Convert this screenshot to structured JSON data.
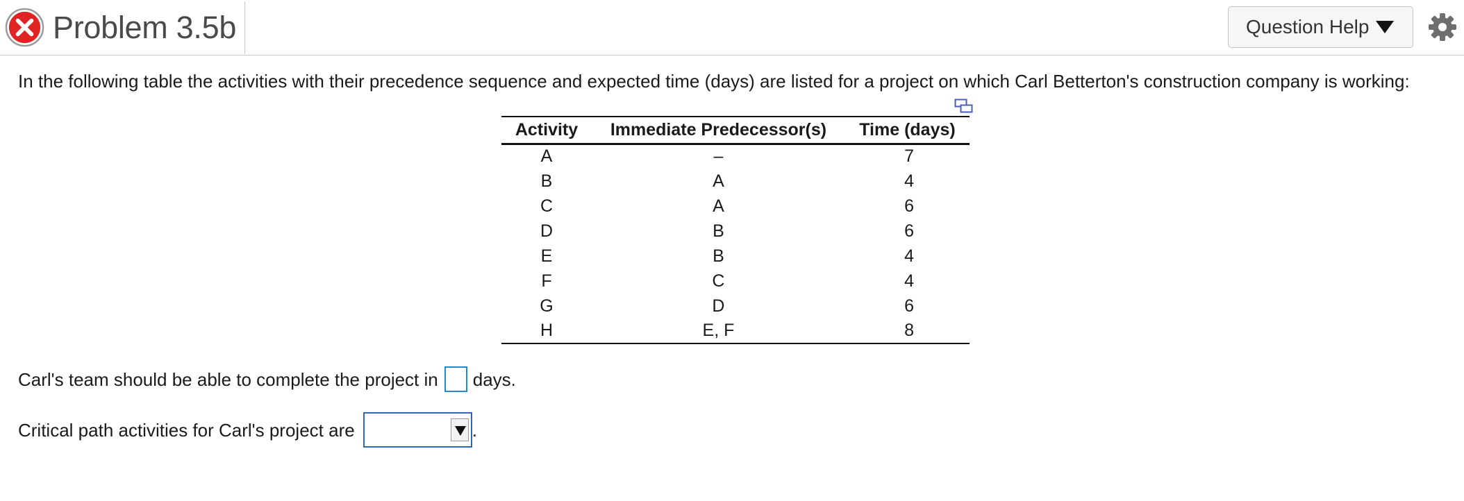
{
  "header": {
    "title": "Problem 3.5b",
    "help_label": "Question Help",
    "status": "incorrect",
    "status_color": "#e02424"
  },
  "intro_text": "In the following table the activities with their precedence sequence and expected time (days) are listed for a project on which Carl Betterton's construction company is working:",
  "table": {
    "headers": [
      "Activity",
      "Immediate Predecessor(s)",
      "Time (days)"
    ],
    "rows": [
      {
        "activity": "A",
        "pred": "–",
        "time": "7"
      },
      {
        "activity": "B",
        "pred": "A",
        "time": "4"
      },
      {
        "activity": "C",
        "pred": "A",
        "time": "6"
      },
      {
        "activity": "D",
        "pred": "B",
        "time": "6"
      },
      {
        "activity": "E",
        "pred": "B",
        "time": "4"
      },
      {
        "activity": "F",
        "pred": "C",
        "time": "4"
      },
      {
        "activity": "G",
        "pred": "D",
        "time": "6"
      },
      {
        "activity": "H",
        "pred": "E, F",
        "time": "8"
      }
    ]
  },
  "question1": {
    "before": "Carl's team should be able to complete the project in",
    "value": "",
    "after": "days."
  },
  "question2": {
    "before": "Critical path activities for Carl's project are",
    "selected": "",
    "after": "."
  },
  "icons": {
    "status": "x-circle-icon",
    "settings": "gear-icon",
    "copy": "copy-table-icon",
    "dropdown": "triangle-down-icon"
  },
  "colors": {
    "input_border": "#2a86c7",
    "select_border": "#2a65c7"
  }
}
